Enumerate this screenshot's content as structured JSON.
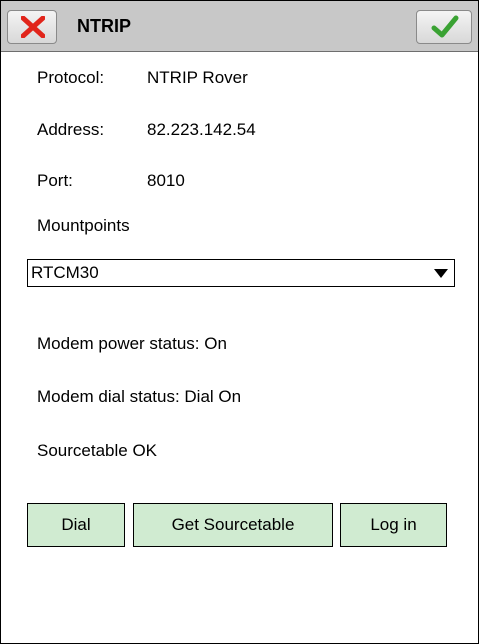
{
  "window": {
    "title": "NTRIP"
  },
  "fields": {
    "protocol_label": "Protocol:",
    "protocol_value": "NTRIP Rover",
    "address_label": "Address:",
    "address_value": "82.223.142.54",
    "port_label": "Port:",
    "port_value": "8010"
  },
  "mountpoints": {
    "label": "Mountpoints",
    "selected": "RTCM30"
  },
  "status": {
    "modem_power": "Modem power status: On",
    "modem_dial": "Modem dial status: Dial On",
    "sourcetable": "Sourcetable OK"
  },
  "buttons": {
    "dial": "Dial",
    "get_sourcetable": "Get Sourcetable",
    "log_in": "Log in"
  },
  "icons": {
    "close": "close-icon",
    "ok": "checkmark-icon"
  },
  "colors": {
    "close_red": "#e1251b",
    "check_green": "#3aa233",
    "button_bg": "#d0ebd1",
    "titlebar_bg": "#c8c8c8"
  }
}
